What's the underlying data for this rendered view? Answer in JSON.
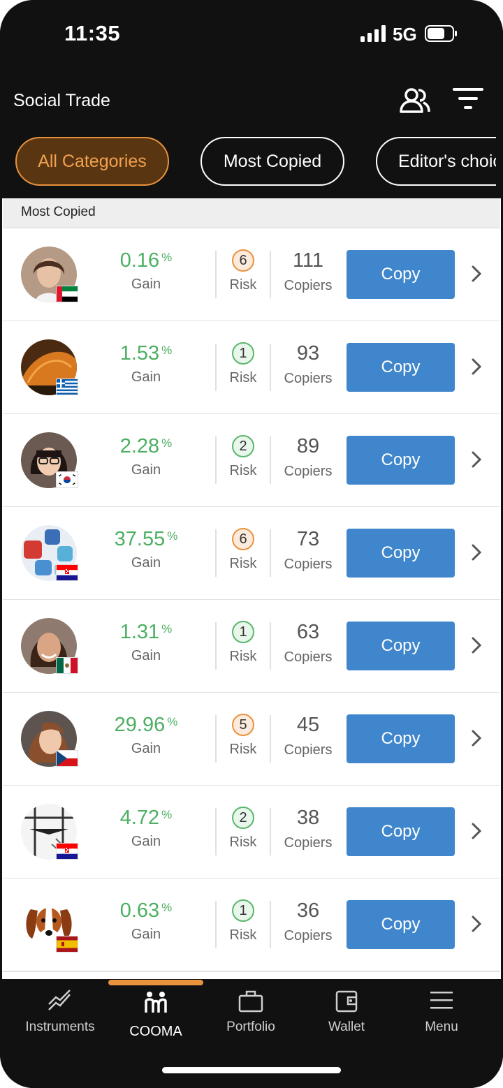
{
  "status": {
    "time": "11:35",
    "network": "5G"
  },
  "header": {
    "title": "Social Trade"
  },
  "chips": [
    "All Categories",
    "Most Copied",
    "Editor's choice"
  ],
  "section_title": "Most Copied",
  "labels": {
    "gain": "Gain",
    "percent": "%",
    "risk": "Risk",
    "copiers": "Copiers",
    "copy": "Copy"
  },
  "traders": [
    {
      "gain": "0.16",
      "risk": "6",
      "copiers": "111",
      "flag": "UAE"
    },
    {
      "gain": "1.53",
      "risk": "1",
      "copiers": "93",
      "flag": "Greece"
    },
    {
      "gain": "2.28",
      "risk": "2",
      "copiers": "89",
      "flag": "South Korea"
    },
    {
      "gain": "37.55",
      "risk": "6",
      "copiers": "73",
      "flag": "Croatia"
    },
    {
      "gain": "1.31",
      "risk": "1",
      "copiers": "63",
      "flag": "Mexico"
    },
    {
      "gain": "29.96",
      "risk": "5",
      "copiers": "45",
      "flag": "Czech Republic"
    },
    {
      "gain": "4.72",
      "risk": "2",
      "copiers": "38",
      "flag": "Croatia"
    },
    {
      "gain": "0.63",
      "risk": "1",
      "copiers": "36",
      "flag": "Spain"
    }
  ],
  "nav": [
    {
      "label": "Instruments",
      "icon": "chart-line-icon"
    },
    {
      "label": "COOMA",
      "icon": "cooma-people-icon",
      "active": true
    },
    {
      "label": "Portfolio",
      "icon": "briefcase-icon"
    },
    {
      "label": "Wallet",
      "icon": "wallet-icon"
    },
    {
      "label": "Menu",
      "icon": "hamburger-icon"
    }
  ],
  "colors": {
    "accent": "#e8923e",
    "copy_button": "#3f86cc",
    "gain": "#4caf62",
    "risk_low": "#58b86b",
    "risk_high": "#e8923e"
  }
}
